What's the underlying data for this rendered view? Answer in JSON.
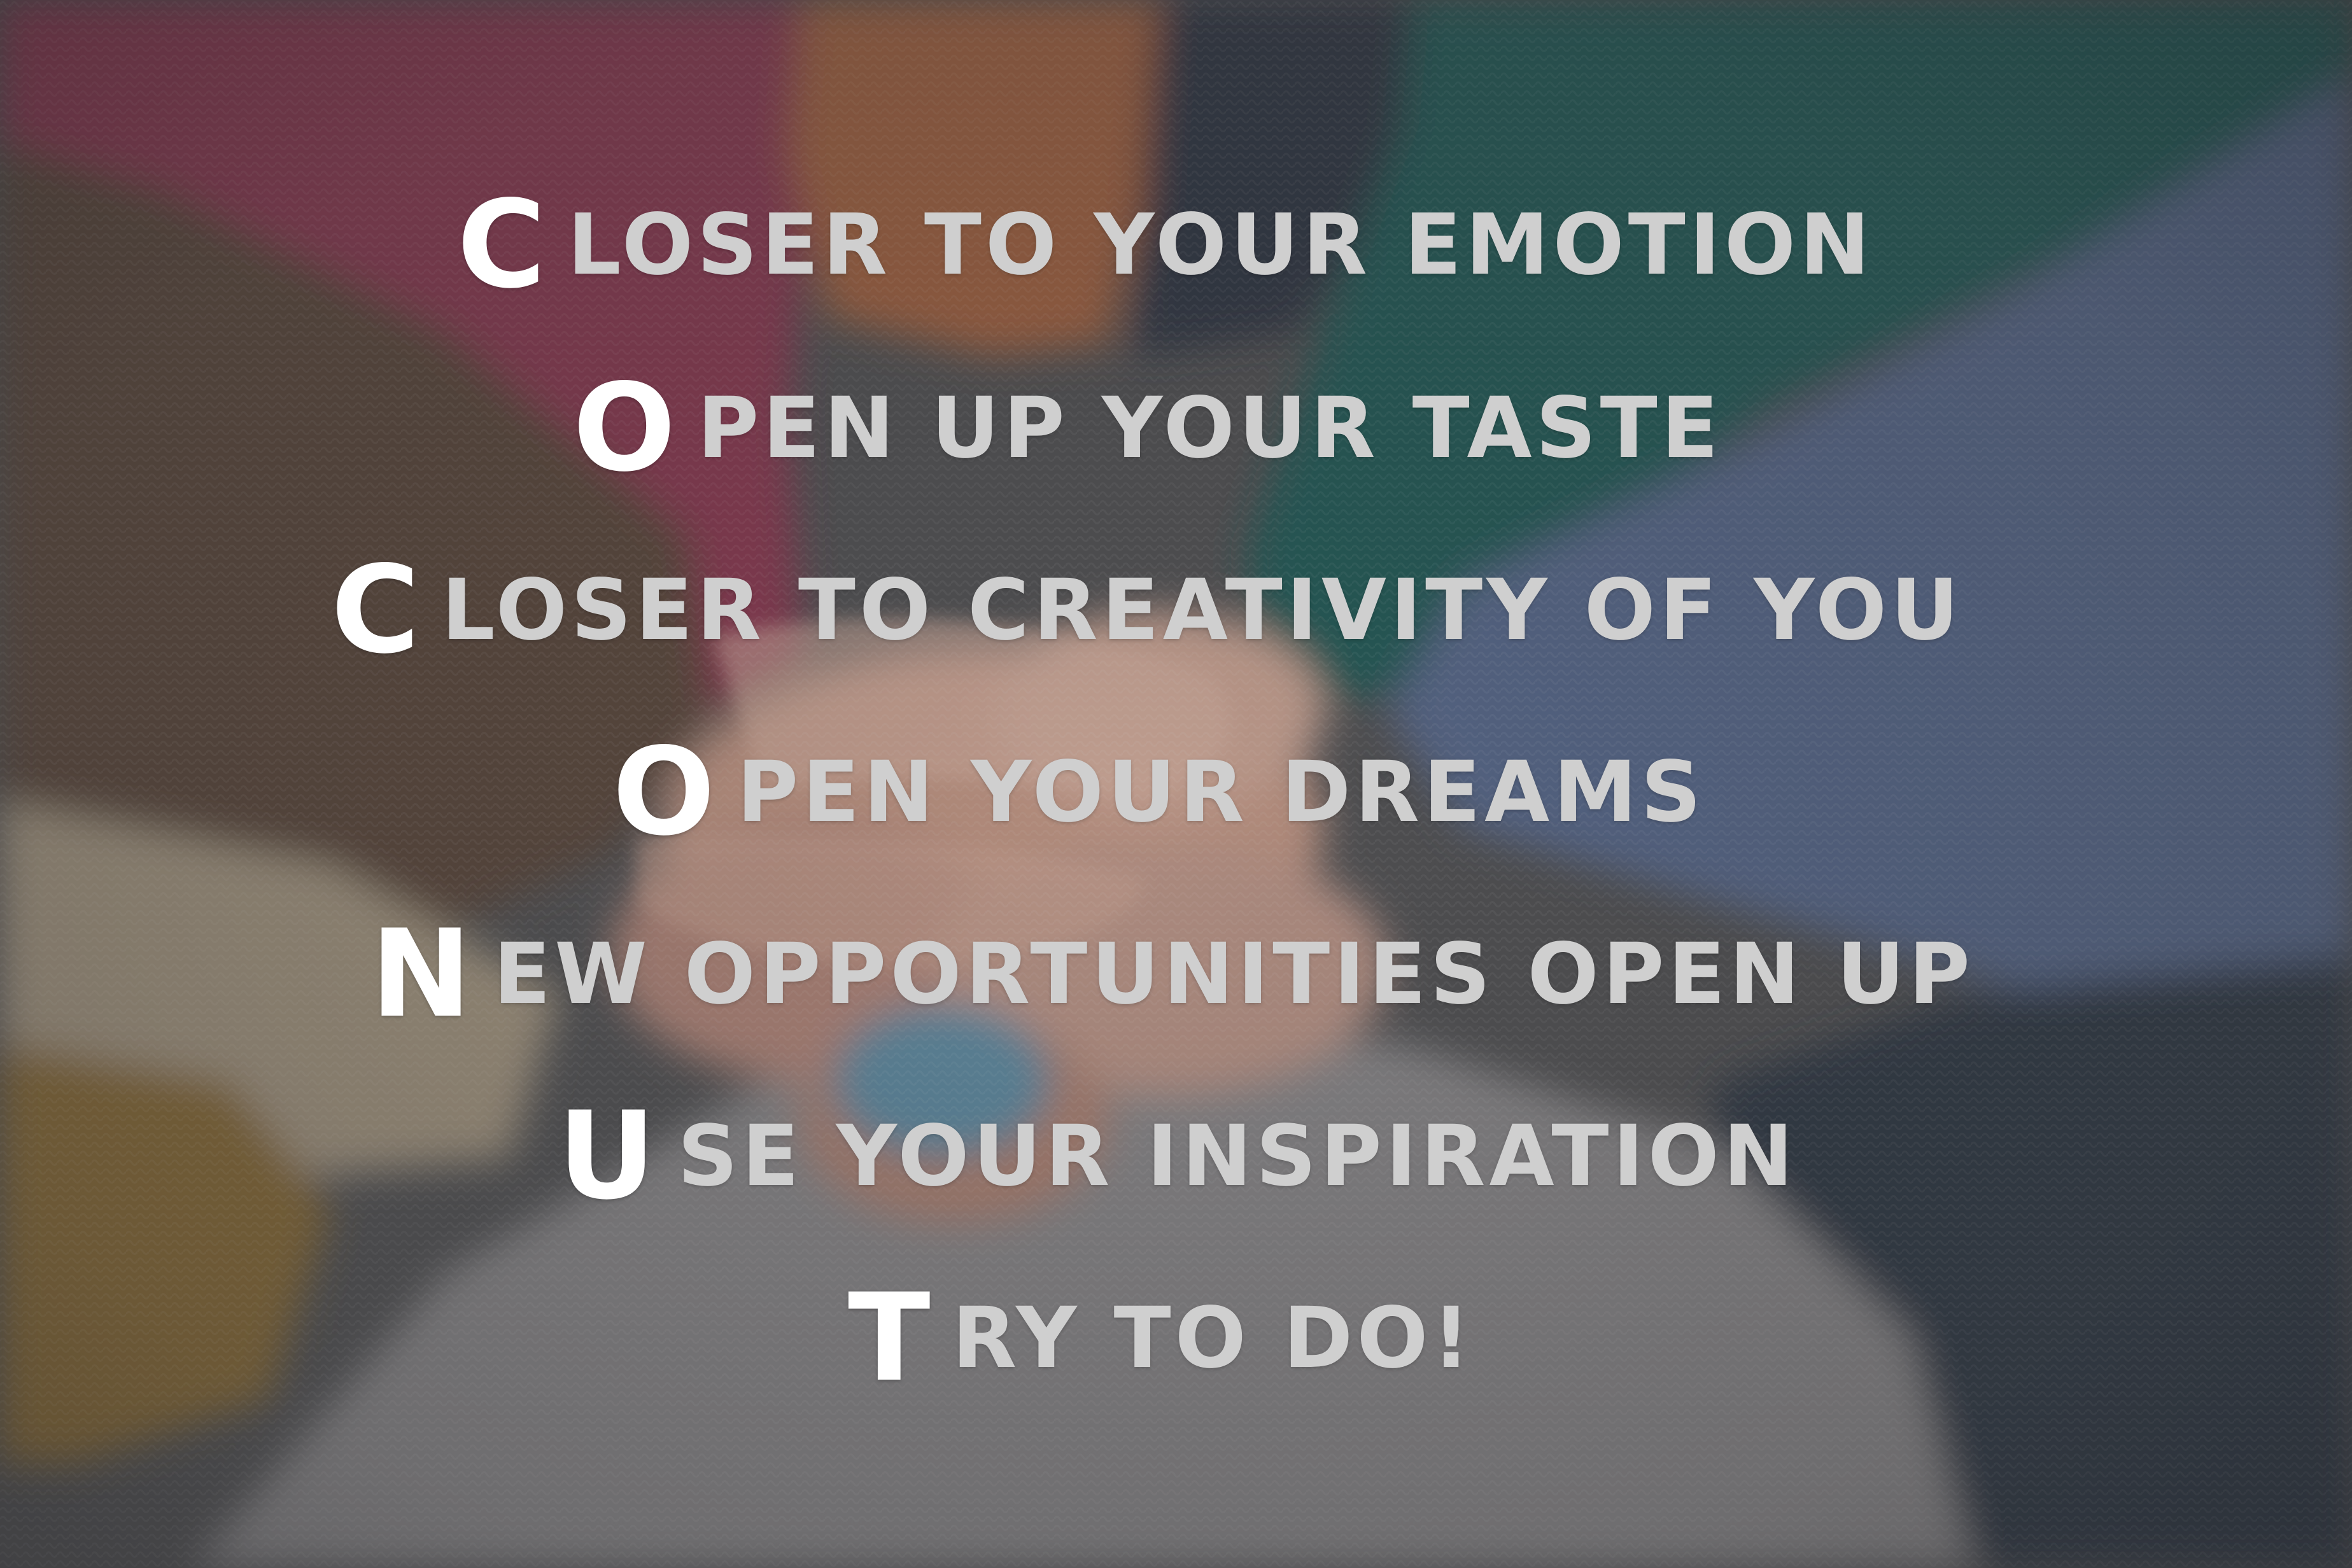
{
  "acrostic": {
    "lines": [
      {
        "initial": "C",
        "rest": "LOSER TO YOUR EMOTION"
      },
      {
        "initial": "O",
        "rest": "PEN UP YOUR TASTE"
      },
      {
        "initial": "C",
        "rest": "LOSER TO CREATIVITY OF YOU"
      },
      {
        "initial": "O",
        "rest": "PEN YOUR DREAMS"
      },
      {
        "initial": "N",
        "rest": "EW OPPORTUNITIES OPEN UP"
      },
      {
        "initial": "U",
        "rest": "SE YOUR INSPIRATION"
      },
      {
        "initial": "T",
        "rest": "RY TO DO!"
      }
    ]
  },
  "colors": {
    "initial": "#ffffff",
    "text": "#cfcfcf",
    "overlay": "#4a4a4d"
  },
  "background": {
    "scene": "stacked-hands-photo"
  }
}
